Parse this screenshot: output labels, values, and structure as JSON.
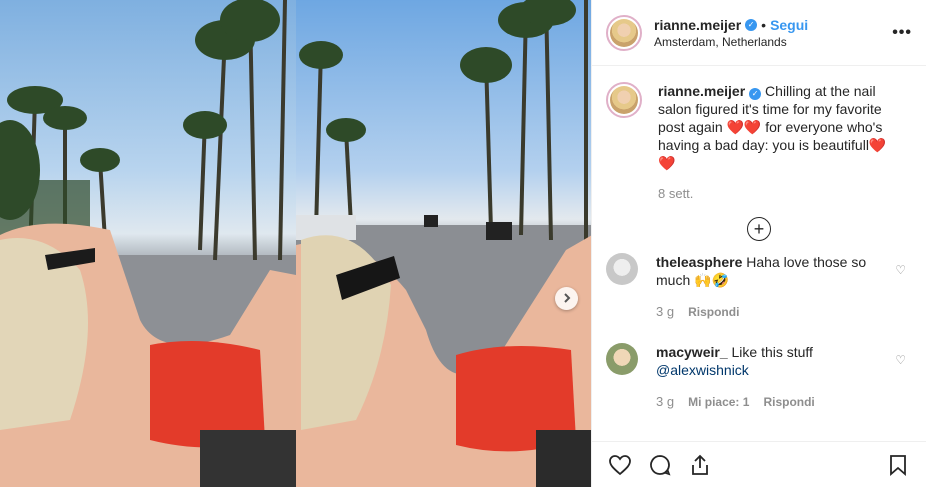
{
  "post": {
    "username": "rianne.meijer",
    "verified_icon": "verified-badge-icon",
    "follow_label": "Segui",
    "separator": "•",
    "location": "Amsterdam, Netherlands",
    "more_label": "•••"
  },
  "caption": {
    "username": "rianne.meijer",
    "text": " Chilling at the nail salon figured it's time for my favorite post again ❤️❤️ for everyone who's having a bad day: you is beautifull❤️❤️",
    "time": "8 sett."
  },
  "load_more_icon": "plus-circle-icon",
  "comments": [
    {
      "username": "theleasphere",
      "text": " Haha love those so much 🙌🤣",
      "time": "3 g",
      "reply": "Rispondi",
      "likes": ""
    },
    {
      "username": "macyweir_",
      "text": " Like this stuff ",
      "mention": "@alexwishnick",
      "time": "3 g",
      "likes": "Mi piace: 1",
      "reply": "Rispondi"
    }
  ],
  "icons": {
    "like": "heart-icon",
    "comment": "comment-bubble-icon",
    "share": "share-icon",
    "save": "bookmark-icon",
    "next": "chevron-right-icon"
  },
  "colors": {
    "accent": "#3897f0",
    "text": "#262626",
    "muted": "#8e8e8e",
    "border": "#efefef"
  }
}
